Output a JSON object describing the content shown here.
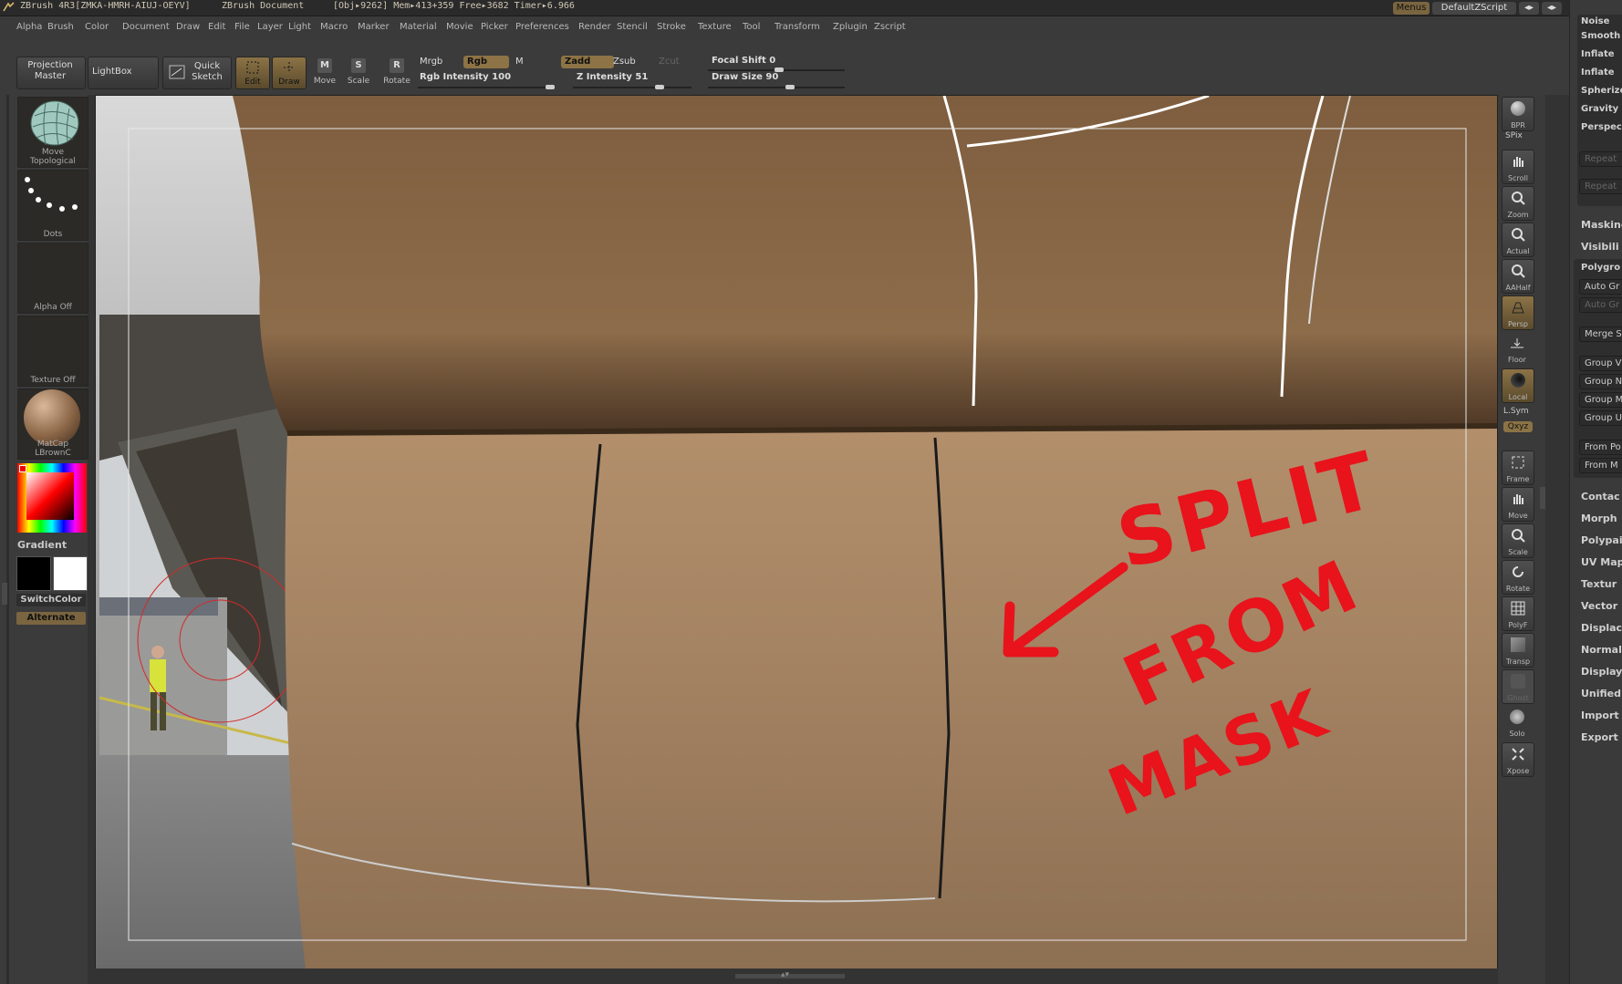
{
  "titlebar": {
    "app": "ZBrush 4R3[ZMKA-HMRH-AIUJ-OEYV]",
    "doc": "ZBrush Document",
    "stats": "[Obj▸9262] Mem▸413+359 Free▸3682 Timer▸6.966",
    "menus_btn": "Menus",
    "script_btn": "DefaultZScript"
  },
  "menubar": [
    "Alpha",
    "Brush",
    "Color",
    "Document",
    "Draw",
    "Edit",
    "File",
    "Layer",
    "Light",
    "Macro",
    "Marker",
    "Material",
    "Movie",
    "Picker",
    "Preferences",
    "Render",
    "Stencil",
    "Stroke",
    "Texture",
    "Tool",
    "Transform",
    "Zplugin",
    "Zscript"
  ],
  "shelf": {
    "projection_master": "Projection Master",
    "lightbox": "LightBox",
    "quick_sketch": "Quick Sketch",
    "edit": "Edit",
    "draw": "Draw",
    "move": "Move",
    "scale": "Scale",
    "rotate": "Rotate",
    "mrgb": "Mrgb",
    "rgb": "Rgb",
    "m": "M",
    "zadd": "Zadd",
    "zsub": "Zsub",
    "zcut": "Zcut",
    "rgb_intensity": "Rgb Intensity 100",
    "z_intensity": "Z Intensity 51",
    "focal_shift": "Focal Shift 0",
    "draw_size": "Draw Size 90"
  },
  "lefttray": {
    "brush_label": "Move Topological",
    "stroke_label": "Dots",
    "alpha_label": "Alpha Off",
    "texture_label": "Texture Off",
    "material_label": "MatCap LBrownC",
    "gradient": "Gradient",
    "switchcolor": "SwitchColor",
    "alternate": "Alternate"
  },
  "canvas": {
    "annotation_line1": "SPLIT",
    "annotation_line2": "FROM",
    "annotation_line3": "MASK",
    "annotation_color": "#e8131b",
    "mesh_color": "#8a6a48"
  },
  "righttools": [
    "BPR",
    "SPix",
    "Scroll",
    "Zoom",
    "Actual",
    "AAHalf",
    "Persp",
    "Floor",
    "Local",
    "L.Sym",
    "Qxyz",
    "Frame",
    "Move",
    "Scale",
    "Rotate",
    "PolyF",
    "Transp",
    "Ghost",
    "Solo",
    "Xpose"
  ],
  "rightpalette": {
    "top_items": [
      "Noise",
      "Smooth",
      "Inflate",
      "Inflate",
      "Spherize",
      "Gravity",
      "Perspec"
    ],
    "repeat1": "Repeat",
    "repeat2": "Repeat",
    "masking": "Masking",
    "visibility": "Visibili",
    "polygroups": "Polygro",
    "auto_groups": "Auto Gr",
    "auto_groups2": "Auto Gr",
    "merge": "Merge S",
    "group_items": [
      "Group V",
      "Group N",
      "Group M",
      "Group U"
    ],
    "from_items": [
      "From Po",
      "From M"
    ],
    "sections": [
      "Contac",
      "Morph",
      "Polypai",
      "UV Map",
      "Textur",
      "Vector",
      "Displac",
      "Normal",
      "Display",
      "Unified",
      "Import",
      "Export"
    ]
  }
}
